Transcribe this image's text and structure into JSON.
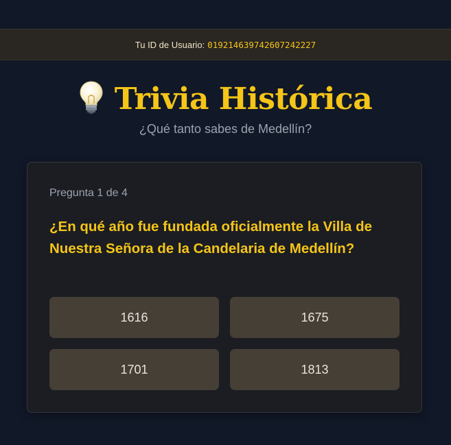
{
  "user_bar": {
    "label": "Tu ID de Usuario:",
    "user_id": "019214639742607242227"
  },
  "header": {
    "icon": "lightbulb-icon",
    "title": "Trivia Histórica",
    "subtitle": "¿Qué tanto sabes de Medellín?"
  },
  "quiz": {
    "counter": "Pregunta 1 de 4",
    "question": "¿En qué año fue fundada oficialmente la Villa de Nuestra Señora de la Candelaria de Medellín?",
    "options": [
      "1616",
      "1675",
      "1701",
      "1813"
    ]
  },
  "colors": {
    "background": "#111827",
    "accent": "#f5c518",
    "card": "#1b1d22",
    "option": "#453f36"
  }
}
